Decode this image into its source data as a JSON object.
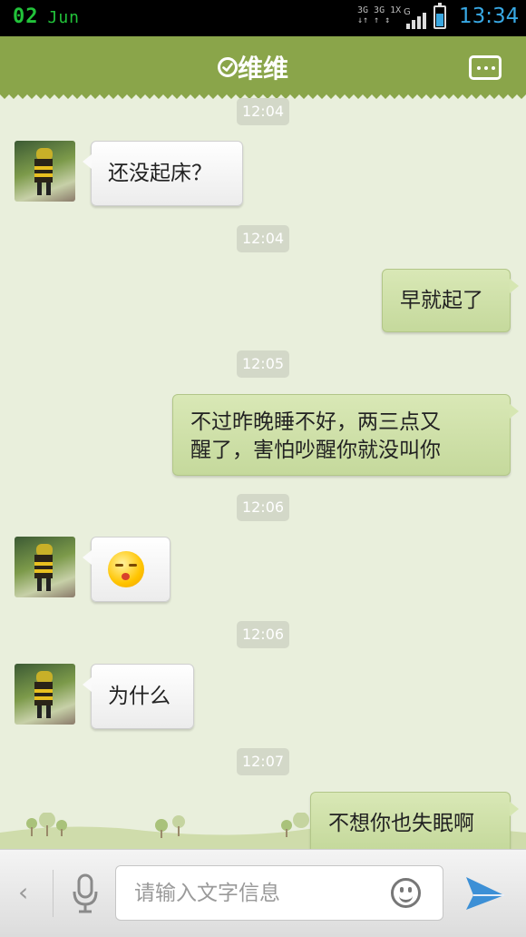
{
  "status_bar": {
    "date_day": "02",
    "date_month": "Jun",
    "network_top": "3G 3G 1X",
    "network_bottom": "↓↑ ↑ ↕",
    "network_g": "G",
    "time": "13:34",
    "battery_color": "#3aa7e0"
  },
  "header": {
    "title": "维维",
    "status_icon": "check-circle-icon",
    "menu_icon": "more-dots-icon",
    "accent_color": "#8aa54a"
  },
  "messages": [
    {
      "time": "12:04"
    },
    {
      "sender": "contact",
      "text": "还没起床？"
    },
    {
      "time": "12:04"
    },
    {
      "sender": "me",
      "text": "早就起了"
    },
    {
      "time": "12:05"
    },
    {
      "sender": "me",
      "text_line1": "不过昨晚睡不好，两三点又",
      "text_line2": "醒了，害怕吵醒你就没叫你"
    },
    {
      "time": "12:06"
    },
    {
      "sender": "contact",
      "emoji": "kiss-face-emoji"
    },
    {
      "time": "12:06"
    },
    {
      "sender": "contact",
      "text": "为什么"
    },
    {
      "time": "12:07"
    },
    {
      "sender": "me",
      "text": "不想你也失眠啊"
    }
  ],
  "input_bar": {
    "back_glyph": "‹",
    "placeholder": "请输入文字信息",
    "mic_icon": "microphone-icon",
    "emoji_icon": "smiley-icon",
    "send_icon": "send-paper-plane-icon"
  }
}
